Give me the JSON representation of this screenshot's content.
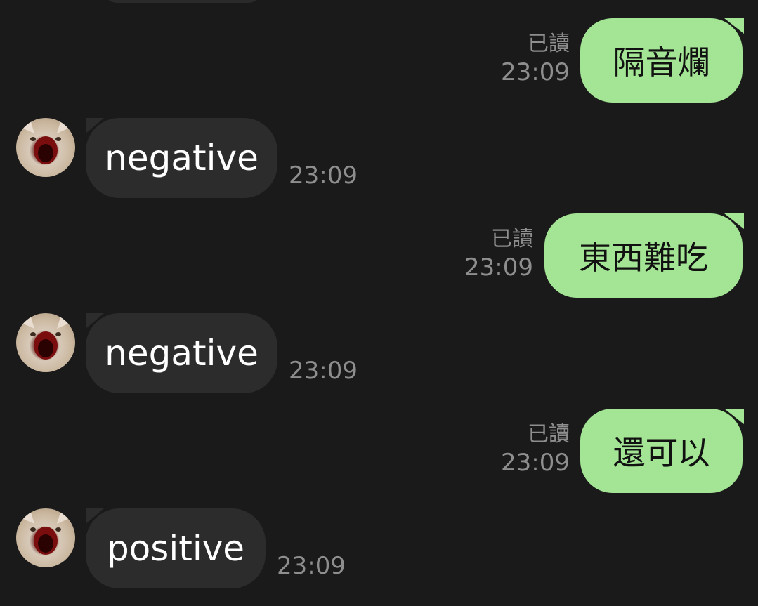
{
  "theme": {
    "background": "#1a1a1b",
    "outgoing_bubble": "#a3e594",
    "incoming_bubble": "#2c2c2d",
    "meta_text": "#8e8e8e"
  },
  "messages": [
    {
      "direction": "outgoing",
      "text": "隔音爛",
      "read": "已讀",
      "time": "23:09"
    },
    {
      "direction": "incoming",
      "avatar": "cat-avatar",
      "text": "negative",
      "time": "23:09"
    },
    {
      "direction": "outgoing",
      "text": "東西難吃",
      "read": "已讀",
      "time": "23:09"
    },
    {
      "direction": "incoming",
      "avatar": "cat-avatar",
      "text": "negative",
      "time": "23:09"
    },
    {
      "direction": "outgoing",
      "text": "還可以",
      "read": "已讀",
      "time": "23:09"
    },
    {
      "direction": "incoming",
      "avatar": "cat-avatar",
      "text": "positive",
      "time": "23:09"
    }
  ]
}
